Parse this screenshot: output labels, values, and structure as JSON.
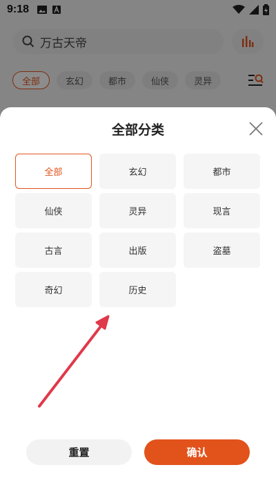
{
  "status_bar": {
    "time": "9:18"
  },
  "search": {
    "value": "万古天帝"
  },
  "categories_bar": {
    "items": [
      "全部",
      "玄幻",
      "都市",
      "仙侠",
      "灵异"
    ],
    "active_index": 0
  },
  "sheet": {
    "title": "全部分类",
    "options": [
      "全部",
      "玄幻",
      "都市",
      "仙侠",
      "灵异",
      "现言",
      "古言",
      "出版",
      "盗墓",
      "奇幻",
      "历史"
    ],
    "selected_index": 0,
    "reset_label": "重置",
    "confirm_label": "确认"
  },
  "colors": {
    "accent": "#e2521b",
    "arrow": "#e0394a"
  }
}
